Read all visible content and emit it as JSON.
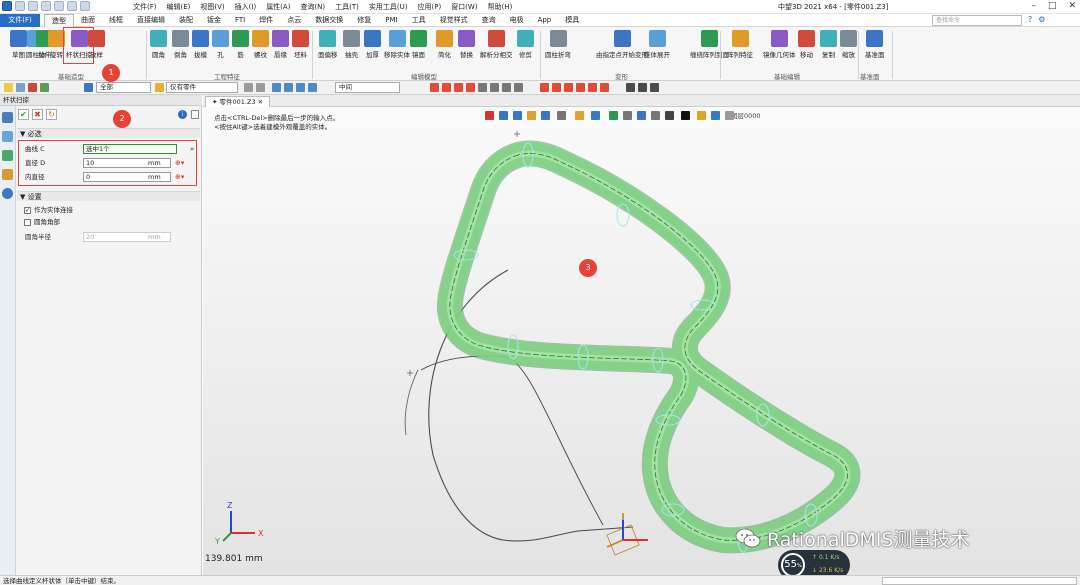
{
  "titlebar": {
    "menus": [
      "文件(F)",
      "编辑(E)",
      "视图(V)",
      "插入(I)",
      "属性(A)",
      "查询(N)",
      "工具(T)",
      "实用工具(U)",
      "应用(P)",
      "窗口(W)",
      "帮助(H)"
    ],
    "app_title": "中望3D 2021 x64 - [零件001.Z3]",
    "search_placeholder": "查找命令"
  },
  "tabs": {
    "file": "文件(F)",
    "items": [
      "造型",
      "曲面",
      "线框",
      "直接编辑",
      "装配",
      "钣金",
      "FTI",
      "焊件",
      "点云",
      "数据交换",
      "修复",
      "PMI",
      "工具",
      "视觉样式",
      "查询",
      "电极",
      "App",
      "模具"
    ],
    "active_index": 0
  },
  "ribbon": {
    "groups": [
      {
        "label": "基础造型",
        "buttons": [
          "草图",
          "圆柱体",
          "拉伸",
          "旋转",
          "杆状扫掠",
          "放样"
        ]
      },
      {
        "label": "工程特征",
        "buttons": [
          "圆角",
          "倒角",
          "拔模",
          "孔",
          "筋",
          "螺纹",
          "唇缘",
          "坯料"
        ]
      },
      {
        "label": "编辑模型",
        "buttons": [
          "面偏移",
          "抽壳",
          "加厚",
          "移除实体",
          "镜面",
          "简化",
          "替换",
          "解析分相交",
          "修剪"
        ]
      },
      {
        "label": "变形",
        "buttons": [
          "圆柱折弯",
          "由指定点开始变形",
          "锥体展开",
          "缠绕阵列到面"
        ]
      },
      {
        "label": "基础编辑",
        "buttons": [
          "阵列特征",
          "镜像几何体",
          "移动",
          "复制",
          "缩放"
        ]
      },
      {
        "label": "基准面",
        "buttons": [
          "基准面"
        ]
      }
    ],
    "highlighted_button": "杆状扫掠"
  },
  "toolbar2": {
    "filter": "全部",
    "scope": "仅有零件",
    "snap": "中间"
  },
  "left_panel": {
    "title": "杆状扫掠",
    "section_required": "必选",
    "fields": [
      {
        "label": "曲线 C",
        "value": "选中1个",
        "unit": ""
      },
      {
        "label": "直径 D",
        "value": "10",
        "unit": "mm"
      },
      {
        "label": "内直径",
        "value": "0",
        "unit": "mm"
      }
    ],
    "section_settings": "设置",
    "checkboxes": [
      {
        "label": "作为实体连接",
        "checked": true
      },
      {
        "label": "圆角角部",
        "checked": false
      }
    ],
    "radius_field": {
      "label": "圆角半径",
      "value": "20",
      "unit": "mm"
    }
  },
  "viewport": {
    "tab": "零件001.Z3",
    "prompt_lines": [
      "点击<CTRL-Del>删除最后一步的输入点。",
      "<按住Alt键>选着建模外观覆盖的实体。"
    ],
    "toolbar_text": "图层0000",
    "measure": "139.801 mm",
    "colors": {
      "tube": "#82d285",
      "tube_edge": "#4fa85a",
      "section": "#9fe8f0"
    }
  },
  "markers": [
    "1",
    "2",
    "3"
  ],
  "statusbar": {
    "text": "选择曲线定义杆状体（单击中键）结束。"
  },
  "perf": {
    "percent": "55",
    "unit": "%",
    "up": "0.1",
    "up_unit": "K/s",
    "down": "23.6",
    "down_unit": "K/s"
  },
  "watermark": {
    "text": "RationalDMIS测量技术"
  }
}
